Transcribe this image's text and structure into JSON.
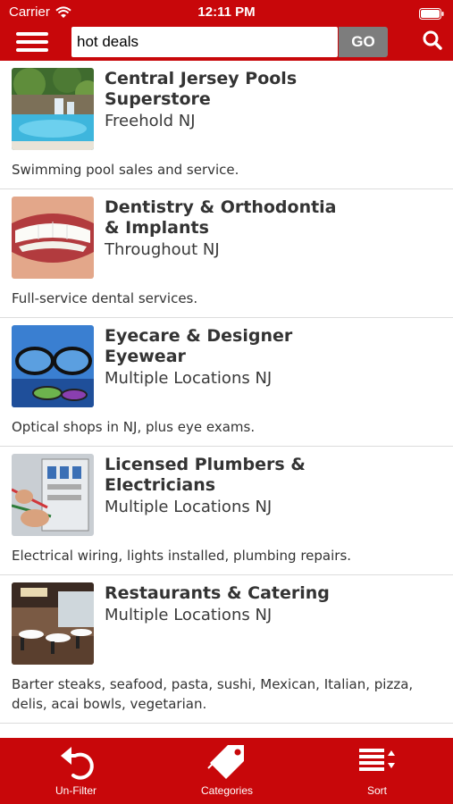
{
  "status_bar": {
    "carrier": "Carrier",
    "time": "12:11 PM"
  },
  "search": {
    "value": "hot deals",
    "go_label": "GO"
  },
  "listings": [
    {
      "title": "Central Jersey Pools Superstore",
      "location": "Freehold NJ",
      "description": "Swimming pool sales and service."
    },
    {
      "title": "Dentistry & Orthodontia & Implants",
      "location": "Throughout NJ",
      "description": "Full-service dental services."
    },
    {
      "title": "Eyecare & Designer Eyewear",
      "location": "Multiple Locations NJ",
      "description": "Optical shops in NJ, plus eye exams."
    },
    {
      "title": "Licensed Plumbers & Electricians",
      "location": "Multiple Locations NJ",
      "description": "Electrical wiring, lights installed, plumbing repairs."
    },
    {
      "title": "Restaurants & Catering",
      "location": "Multiple Locations NJ",
      "description": "Barter steaks, seafood, pasta, sushi, Mexican, Italian, pizza, delis, acai bowls, vegetarian."
    }
  ],
  "tab_bar": {
    "unfilter": "Un-Filter",
    "categories": "Categories",
    "sort": "Sort"
  },
  "colors": {
    "brand_red": "#c8070a",
    "go_gray": "#7d7d7d"
  },
  "icons": [
    "wifi-icon",
    "battery-icon",
    "menu-icon",
    "search-icon",
    "undo-icon",
    "tag-icon",
    "sort-icon"
  ]
}
